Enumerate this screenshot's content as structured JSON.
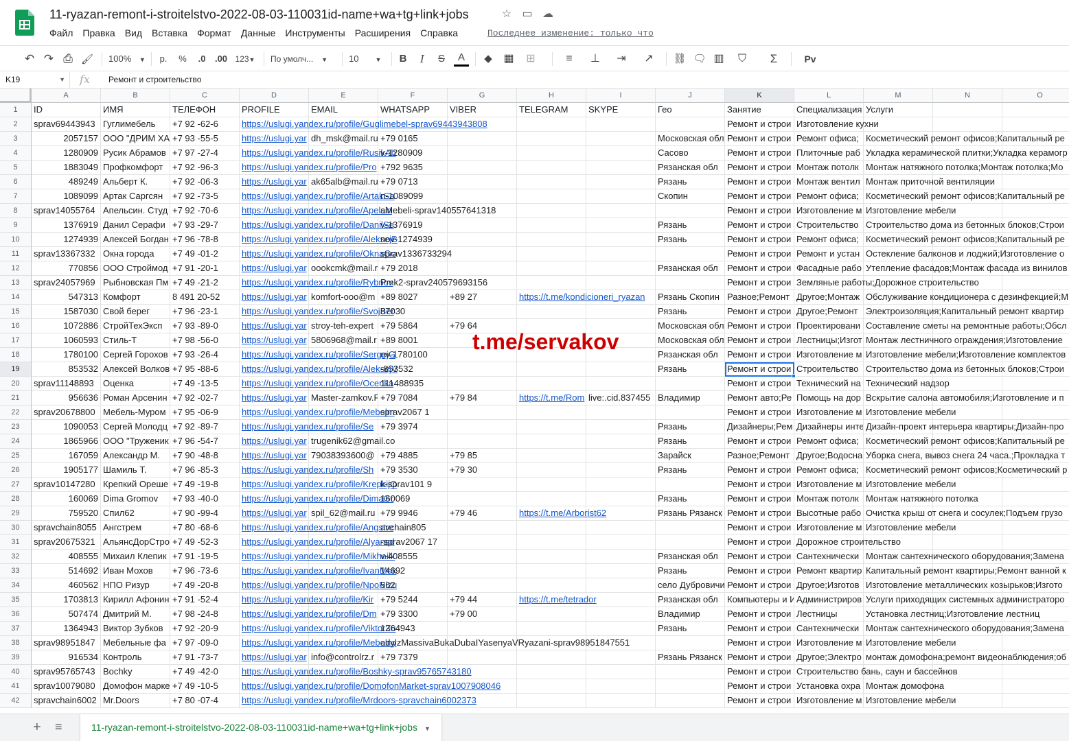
{
  "app": {
    "title": "11-ryazan-remont-i-stroitelstvo-2022-08-03-110031id-name+wa+tg+link+jobs",
    "last_edit": "Последнее изменение: только что",
    "accent": "#188038",
    "link_color": "#1155cc"
  },
  "menu": [
    "Файл",
    "Правка",
    "Вид",
    "Вставка",
    "Формат",
    "Данные",
    "Инструменты",
    "Расширения",
    "Справка"
  ],
  "title_icons": [
    "star-icon",
    "move-to-folder-icon",
    "cloud-status-icon"
  ],
  "toolbar": {
    "undo": "↶",
    "redo": "↷",
    "print": "⎙",
    "paint": "🖌",
    "zoom": "100%",
    "currency": "р.",
    "percent": "%",
    "dec_less": ".0",
    "dec_more": ".00",
    "format": "123",
    "font": "По умолч...",
    "font_size": "10",
    "bold": "B",
    "italic": "I",
    "strike": "S",
    "text_color": "A",
    "fill": "◆",
    "borders": "▦",
    "merge": "⊞",
    "align": "≡",
    "valign": "⊥",
    "wrap": "⇥",
    "rotate": "↗",
    "link": "⛓",
    "comment": "🗨",
    "chart": "▥",
    "filter": "⛉",
    "functions": "Σ",
    "input": "Pv"
  },
  "formula": {
    "cell_ref": "K19",
    "fx": "fx",
    "value": "Ремонт и строительство"
  },
  "columns": [
    "A",
    "B",
    "C",
    "D",
    "E",
    "F",
    "G",
    "H",
    "I",
    "J",
    "K",
    "L",
    "M",
    "N",
    "O"
  ],
  "active_col": "K",
  "active_row": 19,
  "rows": [
    {
      "n": 1,
      "c": [
        "ID",
        "ИМЯ",
        "ТЕЛЕФОН",
        "PROFILE",
        "EMAIL",
        "WHATSAPP",
        "VIBER",
        "TELEGRAM",
        "SKYPE",
        "Гео",
        "Занятие",
        "Специализация",
        "Услуги",
        "",
        ""
      ]
    },
    {
      "n": 2,
      "c": [
        "sprav69443943",
        "Гуглимебель",
        "+7 92      -62-6",
        "https://uslugi.yandex.ru/profile/Guglimebel-sprav69443943808",
        "",
        "",
        "",
        "",
        "",
        "",
        "Ремонт и строи",
        "Изготовление кухни",
        "",
        "",
        ""
      ]
    },
    {
      "n": 3,
      "c": [
        "2057157",
        "ООО \"ДРИМ ХА",
        "+7 93      -55-5",
        "https://uslugi.yar",
        "dh_msk@mail.ru",
        "+79   0165",
        "",
        "",
        "",
        "Московская обл",
        "Ремонт и строи",
        "Ремонт офиса;",
        "Косметический ремонт офисов;Капитальный ре",
        "",
        ""
      ]
    },
    {
      "n": 4,
      "c": [
        "1280909",
        "Русик Абрамов",
        "+7 97      -27-4",
        "https://uslugi.yandex.ru/profile/RusikAb",
        "",
        "v-1280909",
        "",
        "",
        "",
        "Сасово",
        "Ремонт и строи",
        "Плиточные раб",
        "Укладка керамической плитки;Укладка керамогр",
        "",
        ""
      ]
    },
    {
      "n": 5,
      "c": [
        "1883049",
        "Профкомфорт",
        "+7 92      -96-3",
        "https://uslugi.yandex.ru/profile/Pro",
        "",
        "+792    9635",
        "",
        "",
        "",
        "Рязанская обл",
        "Ремонт и строи",
        "Монтаж потолк",
        "Монтаж натяжного потолка;Монтаж потолка;Мо",
        "",
        ""
      ]
    },
    {
      "n": 6,
      "c": [
        "489249",
        "Альберт К.",
        "+7 92      -06-3",
        "https://uslugi.yar",
        "ak65alb@mail.ru",
        "+79   0713",
        "",
        "",
        "",
        "Рязань",
        "Ремонт и строи",
        "Монтаж вентил",
        "Монтаж приточной вентиляции",
        "",
        ""
      ]
    },
    {
      "n": 7,
      "c": [
        "1089099",
        "Артак Саргсян",
        "+7 92      -73-5",
        "https://uslugi.yandex.ru/profile/ArtakSa",
        "",
        "n-1089099",
        "",
        "",
        "",
        "Скопин",
        "Ремонт и строи",
        "Ремонт офиса;",
        "Косметический ремонт офисов;Капитальный ре",
        "",
        ""
      ]
    },
    {
      "n": 8,
      "c": [
        "sprav14055764",
        "Апельсин. Студ",
        "+7 92      -70-6",
        "https://uslugi.yandex.ru/profile/Apelsin",
        "",
        "aMebeli-sprav140557641318",
        "",
        "",
        "",
        "",
        "Ремонт и строи",
        "Изготовление м",
        "Изготовление мебели",
        "",
        ""
      ]
    },
    {
      "n": 9,
      "c": [
        "1376919",
        "Данил Серафи",
        "+7 93      -29-7",
        "https://uslugi.yandex.ru/profile/DanilSe",
        "",
        "v-1376919",
        "",
        "",
        "",
        "Рязань",
        "Ремонт и строи",
        "Строительство",
        "Строительство дома из бетонных блоков;Строи",
        "",
        ""
      ]
    },
    {
      "n": 10,
      "c": [
        "1274939",
        "Алексей Богдан",
        "+7 96      -78-8",
        "https://uslugi.yandex.ru/profile/AleksejB",
        "",
        "nov-1274939",
        "",
        "",
        "",
        "Рязань",
        "Ремонт и строи",
        "Ремонт офиса;",
        "Косметический ремонт офисов;Капитальный ре",
        "",
        ""
      ]
    },
    {
      "n": 11,
      "c": [
        "sprav13367332",
        "Окна города",
        "+7 49      -01-2",
        "https://uslugi.yandex.ru/profile/OknaGo",
        "",
        "sprav1336733294",
        "",
        "",
        "",
        "",
        "Ремонт и строи",
        "Ремонт и устан",
        "Остекление балконов и лоджий;Изготовление о",
        "",
        ""
      ]
    },
    {
      "n": 12,
      "c": [
        "770856",
        "ООО Строймод",
        "+7 91      -20-1",
        "https://uslugi.yar",
        "oookcmk@mail.r",
        "+79    2018",
        "",
        "",
        "",
        "Рязанская обл",
        "Ремонт и строи",
        "Фасадные рабо",
        "Утепление фасадов;Монтаж фасада из винилов",
        "",
        ""
      ]
    },
    {
      "n": 13,
      "c": [
        "sprav24057969",
        "Рыбновская Пм",
        "+7 49      -21-2",
        "https://uslugi.yandex.ru/profile/Rybnov",
        "",
        "Pmk2-sprav240579693156",
        "",
        "",
        "",
        "",
        "Ремонт и строи",
        "Земляные работы;Дорожное строительство",
        "",
        "",
        ""
      ]
    },
    {
      "n": 14,
      "c": [
        "547313",
        "Комфорт",
        "8 491      20-52",
        "https://uslugi.yar",
        "komfort-ooo@m",
        "+89    8027",
        "+89    27",
        "https://t.me/kondicioneri_ryazan",
        "",
        "Рязань Скопин",
        "Разное;Ремонт",
        "Другое;Монтаж",
        "Обслуживание кондиционера с дезинфекцией;М",
        "",
        ""
      ]
    },
    {
      "n": 15,
      "c": [
        "1587030",
        "Свой берег",
        "+7 96      -23-1",
        "https://uslugi.yandex.ru/profile/SvojBer",
        "",
        "87030",
        "",
        "",
        "",
        "Рязань",
        "Ремонт и строи",
        "Другое;Ремонт",
        "Электроизоляция;Капитальный ремонт квартир",
        "",
        ""
      ]
    },
    {
      "n": 16,
      "c": [
        "1072886",
        "СтройТехЭксп",
        "+7 93      -89-0",
        "https://uslugi.yar",
        "stroy-teh-expert",
        "+79    5864",
        "+79    64",
        "",
        "",
        "Московская обл",
        "Ремонт и строи",
        "Проектировани",
        "Составление сметы на ремонтные работы;Обсл",
        "",
        ""
      ]
    },
    {
      "n": 17,
      "c": [
        "1060593",
        "Стиль-Т",
        "+7 98      -56-0",
        "https://uslugi.yar",
        "5806968@mail.r",
        "+89    8001",
        "",
        "",
        "",
        "Московская обл",
        "Ремонт и строи",
        "Лестницы;Изгот",
        "Монтаж лестничного ограждения;Изготовление",
        "",
        ""
      ]
    },
    {
      "n": 18,
      "c": [
        "1780100",
        "Сергей Горохов",
        "+7 93      -26-4",
        "https://uslugi.yandex.ru/profile/SergejG",
        "",
        "ov-1780100",
        "",
        "",
        "",
        "Рязанская обл",
        "Ремонт и строи",
        "Изготовление м",
        "Изготовление мебели;Изготовление комплектов",
        "",
        ""
      ]
    },
    {
      "n": 19,
      "c": [
        "853532",
        "Алексей Волков",
        "+7 95      -88-6",
        "https://uslugi.yandex.ru/profile/AleksejV",
        "",
        "-853532",
        "",
        "",
        "",
        "Рязань",
        "Ремонт и строи",
        "Строительство",
        "Строительство дома из бетонных блоков;Строи",
        "",
        ""
      ]
    },
    {
      "n": 20,
      "c": [
        "sprav11148893",
        "Оценка",
        "+7 49      -13-5",
        "https://uslugi.yandex.ru/profile/Ocenka",
        "",
        "111488935",
        "",
        "",
        "",
        "",
        "Ремонт и строи",
        "Технический на",
        "Технический надзор",
        "",
        ""
      ]
    },
    {
      "n": 21,
      "c": [
        "956636",
        "Роман Арсенин",
        "+7 92      -02-7",
        "https://uslugi.yar",
        "Master-zamkov.F",
        "+79    7084",
        "+79    84",
        "https://t.me/Rom",
        "live:.cid.837455",
        "Владимир",
        "Ремонт авто;Ре",
        "Помощь на дор",
        "Вскрытие салона автомобиля;Изготовление и п",
        "",
        ""
      ]
    },
    {
      "n": 22,
      "c": [
        "sprav20678800",
        "Мебель-Муром",
        "+7 95      -06-9",
        "https://uslugi.yandex.ru/profile/Mebelm",
        "",
        "sprav2067     1",
        "",
        "",
        "",
        "",
        "Ремонт и строи",
        "Изготовление м",
        "Изготовление мебели",
        "",
        ""
      ]
    },
    {
      "n": 23,
      "c": [
        "1090053",
        "Сергей Молодц",
        "+7 92      -89-7",
        "https://uslugi.yandex.ru/profile/Se",
        "",
        "+79    3974",
        "",
        "",
        "",
        "Рязань",
        "Дизайнеры;Рем",
        "Дизайнеры инте",
        "Дизайн-проект интерьера квартиры;Дизайн-про",
        "",
        ""
      ]
    },
    {
      "n": 24,
      "c": [
        "1865966",
        "ООО \"Труженик",
        "+7 96      -54-7",
        "https://uslugi.yar",
        "trugenik62@gmail.co",
        "",
        "",
        "",
        "",
        "Рязань",
        "Ремонт и строи",
        "Ремонт офиса;",
        "Косметический ремонт офисов;Капитальный ре",
        "",
        ""
      ]
    },
    {
      "n": 25,
      "c": [
        "167059",
        "Александр М.",
        "+7 90      -48-8",
        "https://uslugi.yar",
        "79038393600@",
        "+79    4885",
        "+79    85",
        "",
        "",
        "Зарайск",
        "Разное;Ремонт",
        "Другое;Водосна",
        "Уборка снега, вывоз снега 24 часа.;Прокладка т",
        "",
        ""
      ]
    },
    {
      "n": 26,
      "c": [
        "1905177",
        "Шамиль Т.",
        "+7 96      -85-3",
        "https://uslugi.yandex.ru/profile/Sh",
        "",
        "+79    3530",
        "+79    30",
        "",
        "",
        "Рязань",
        "Ремонт и строи",
        "Ремонт офиса;",
        "Косметический ремонт офисов;Косметический р",
        "",
        ""
      ]
    },
    {
      "n": 27,
      "c": [
        "sprav10147280",
        "Крепкий Ореше",
        "+7 49      -19-8",
        "https://uslugi.yandex.ru/profile/KrepkijO",
        "",
        "k-sprav101     9",
        "",
        "",
        "",
        "",
        "Ремонт и строи",
        "Изготовление м",
        "Изготовление мебели",
        "",
        ""
      ]
    },
    {
      "n": 28,
      "c": [
        "160069",
        "Dima Gromov",
        "+7 93      -40-0",
        "https://uslugi.yandex.ru/profile/DimaGr",
        "",
        "160069",
        "",
        "",
        "",
        "Рязань",
        "Ремонт и строи",
        "Монтаж потолк",
        "Монтаж натяжного потолка",
        "",
        ""
      ]
    },
    {
      "n": 29,
      "c": [
        "759520",
        "Спил62",
        "+7 90      -99-4",
        "https://uslugi.yar",
        "spil_62@mail.ru",
        "+79    9946",
        "+79    46",
        "https://t.me/Arborist62",
        "",
        "Рязань Рязанск",
        "Ремонт и строи",
        "Высотные рабо",
        "Очистка крыш от снега и сосулек;Подъем грузо",
        "",
        ""
      ]
    },
    {
      "n": 30,
      "c": [
        "spravchain8055",
        "Ангстрем",
        "+7 80      -68-6",
        "https://uslugi.yandex.ru/profile/Angstre",
        "",
        "avchain805",
        "",
        "",
        "",
        "",
        "Ремонт и строи",
        "Изготовление м",
        "Изготовление мебели",
        "",
        ""
      ]
    },
    {
      "n": 31,
      "c": [
        "sprav20675321",
        "АльянсДорСтро",
        "+7 49      -52-3",
        "https://uslugi.yandex.ru/profile/Alyansd",
        "",
        "-sprav2067     17",
        "",
        "",
        "",
        "",
        "Ремонт и строи",
        "Дорожное строительство",
        "",
        "",
        ""
      ]
    },
    {
      "n": 32,
      "c": [
        "408555",
        "Михаил Клепик",
        "+7 91      -19-5",
        "https://uslugi.yandex.ru/profile/Mikhailk",
        "",
        "v-408555",
        "",
        "",
        "",
        "Рязанская обл",
        "Ремонт и строи",
        "Сантехнически",
        "Монтаж сантехнического оборудования;Замена",
        "",
        ""
      ]
    },
    {
      "n": 33,
      "c": [
        "514692",
        "Иван Мохов",
        "+7 96      -73-6",
        "https://uslugi.yandex.ru/profile/IvanMok",
        "",
        "14692",
        "",
        "",
        "",
        "Рязань",
        "Ремонт и строи",
        "Ремонт квартир",
        "Капитальный ремонт квартиры;Ремонт ванной к",
        "",
        ""
      ]
    },
    {
      "n": 34,
      "c": [
        "460562",
        "НПО Ризур",
        "+7 49      -20-8",
        "https://uslugi.yandex.ru/profile/NpoRizu",
        "",
        "562",
        "",
        "",
        "",
        "село Дубровичи",
        "Ремонт и строи",
        "Другое;Изготов",
        "Изготовление металлических козырьков;Изгото",
        "",
        ""
      ]
    },
    {
      "n": 35,
      "c": [
        "1703813",
        "Кирилл Афонин",
        "+7 91      -52-4",
        "https://uslugi.yandex.ru/profile/Kir",
        "",
        "+79    5244",
        "+79    44",
        "https://t.me/tetrador",
        "",
        "Рязанская обл",
        "Компьютеры и И",
        "Администриров",
        "Услуги приходящих системных администраторо",
        "",
        ""
      ]
    },
    {
      "n": 36,
      "c": [
        "507474",
        "Дмитрий М.",
        "+7 98      -24-8",
        "https://uslugi.yandex.ru/profile/Dm",
        "",
        "+79    3300",
        "+79    00",
        "",
        "",
        "Владимир",
        "Ремонт и строи",
        "Лестницы",
        "Установка лестниц;Изготовление лестниц",
        "",
        ""
      ]
    },
    {
      "n": 37,
      "c": [
        "1364943",
        "Виктор Зубков",
        "+7 92      -20-9",
        "https://uslugi.yandex.ru/profile/ViktorZu",
        "",
        "1364943",
        "",
        "",
        "",
        "Рязань",
        "Ремонт и строи",
        "Сантехнически",
        "Монтаж сантехнического оборудования;Замена",
        "",
        ""
      ]
    },
    {
      "n": 38,
      "c": [
        "sprav98951847",
        "Мебельные фа",
        "+7 97      -09-0",
        "https://uslugi.yandex.ru/profile/Mebelny",
        "",
        "adylzMassivaBukaDubaIYasenyaVRyazani-sprav98951847551",
        "",
        "",
        "",
        "",
        "Ремонт и строи",
        "Изготовление м",
        "Изготовление мебели",
        "",
        ""
      ]
    },
    {
      "n": 39,
      "c": [
        "916534",
        "Контроль",
        "+7 91      -73-7",
        "https://uslugi.yar",
        "info@controlrz.r",
        "+79    7379",
        "",
        "",
        "",
        "Рязань Рязанск",
        "Ремонт и строи",
        "Другое;Электро",
        "монтаж домофона;ремонт видеонаблюдения;об",
        "",
        ""
      ]
    },
    {
      "n": 40,
      "c": [
        "sprav95765743",
        "Bochky",
        "+7 49      -42-0",
        "https://uslugi.yandex.ru/profile/Boshky-sprav95765743180",
        "",
        "",
        "",
        "",
        "",
        "",
        "Ремонт и строи",
        "Строительство бань, саун и бассейнов",
        "",
        "",
        ""
      ]
    },
    {
      "n": 41,
      "c": [
        "sprav10079080",
        "Домофон марке",
        "+7 49      -10-5",
        "https://uslugi.yandex.ru/profile/DomofonMarket-sprav1007908046",
        "",
        "",
        "",
        "",
        "",
        "",
        "Ремонт и строи",
        "Установка охра",
        "Монтаж домофона",
        "",
        ""
      ]
    },
    {
      "n": 42,
      "c": [
        "spravchain6002",
        "Mr.Doors",
        "+7 80      -07-4",
        "https://uslugi.yandex.ru/profile/Mrdoors-spravchain6002373",
        "",
        "",
        "",
        "",
        "",
        "",
        "Ремонт и строи",
        "Изготовление м",
        "Изготовление мебели",
        "",
        ""
      ]
    }
  ],
  "watermark": "t.me/servakov",
  "sheet": {
    "add": "+",
    "all": "≡",
    "tab": "11-ryazan-remont-i-stroitelstvo-2022-08-03-110031id-name+wa+tg+link+jobs"
  }
}
